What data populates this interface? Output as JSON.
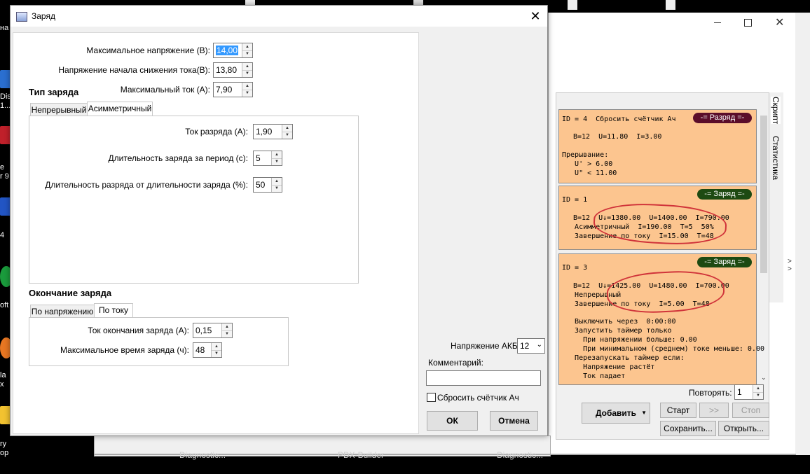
{
  "desktop": {
    "icon_labels": [
      "на",
      "Dis\n1...",
      "е\nr 9",
      "4",
      "oft",
      "la\nx",
      "ry\nop"
    ],
    "taskbar_items": [
      "Diagnostic...",
      "PDX-Builder",
      "Diagnostic..."
    ]
  },
  "dialog": {
    "title": "Заряд",
    "fields": {
      "max_voltage_label": "Максимальное напряжение (В):",
      "max_voltage_value": "14,00",
      "current_decrease_start_label": "Напряжение начала снижения тока(В):",
      "current_decrease_start_value": "13,80",
      "max_current_label": "Максимальный ток (А):",
      "max_current_value": "7,90"
    },
    "charge_type": {
      "heading": "Тип заряда",
      "tabs": [
        "Непрерывный",
        "Асимметричный"
      ],
      "active_tab": "Асимметричный",
      "discharge_current_label": "Ток разряда (А):",
      "discharge_current_value": "1,90",
      "charge_duration_label": "Длительность заряда за период (с):",
      "charge_duration_value": "5",
      "discharge_duration_label": "Длительность разряда от длительности заряда (%):",
      "discharge_duration_value": "50"
    },
    "charge_end": {
      "heading": "Окончание заряда",
      "tabs": [
        "По напряжению",
        "По току"
      ],
      "active_tab": "По току",
      "end_current_label": "Ток окончания заряда (А):",
      "end_current_value": "0,15",
      "max_time_label": "Максимальное время заряда (ч):",
      "max_time_value": "48"
    },
    "battery_voltage_label": "Напряжение АКБ:",
    "battery_voltage_value": "12",
    "comment_label": "Комментарий:",
    "comment_value": "",
    "reset_counter_label": "Сбросить счётчик Ач",
    "reset_counter_checked": false,
    "ok_label": "ОК",
    "cancel_label": "Отмена"
  },
  "script_panel": {
    "tabs": [
      "Скрипт",
      "Статистика"
    ],
    "cards": [
      {
        "id_line": "ID = 4  Сбросить счётчик Ач",
        "badge": "-= Разряд =-",
        "badge_color": "#5a0d2a",
        "lines": [
          "B=12  U=11.80  I=3.00",
          "",
          "Прерывание:",
          "   U' > 6.00",
          "   U\" < 11.00"
        ]
      },
      {
        "id_line": "ID = 1",
        "badge": "-= Заряд =-",
        "badge_color": "#1d4a12",
        "lines": [
          "B=12  U↓=1380.00  U=1400.00  I=790.00",
          "   Асимметричный  I=190.00  T=5  50%",
          "   Завершение по току  I=15.00  T=48"
        ]
      },
      {
        "id_line": "ID = 3",
        "badge": "-= Заряд =-",
        "badge_color": "#1d4a12",
        "lines": [
          "B=12  U↓=1425.00  U=1480.00  I=700.00",
          "   Непрерывный",
          "   Завершение по току  I=5.00  T=48",
          "",
          "   Выключить через  0:00:00",
          "   Запустить таймер только",
          "     При напряжении больше: 0.00",
          "     При минимальном (среднем) токе меньше: 0.00",
          "   Перезапускать таймер если:",
          "     Напряжение растёт",
          "     Ток падает"
        ]
      }
    ],
    "repeat_label": "Повторять:",
    "repeat_value": "1",
    "add_label": "Добавить",
    "start_label": "Старт",
    "next_label": ">>",
    "stop_label": "Стоп",
    "save_label": "Сохранить...",
    "open_label": "Открыть..."
  }
}
